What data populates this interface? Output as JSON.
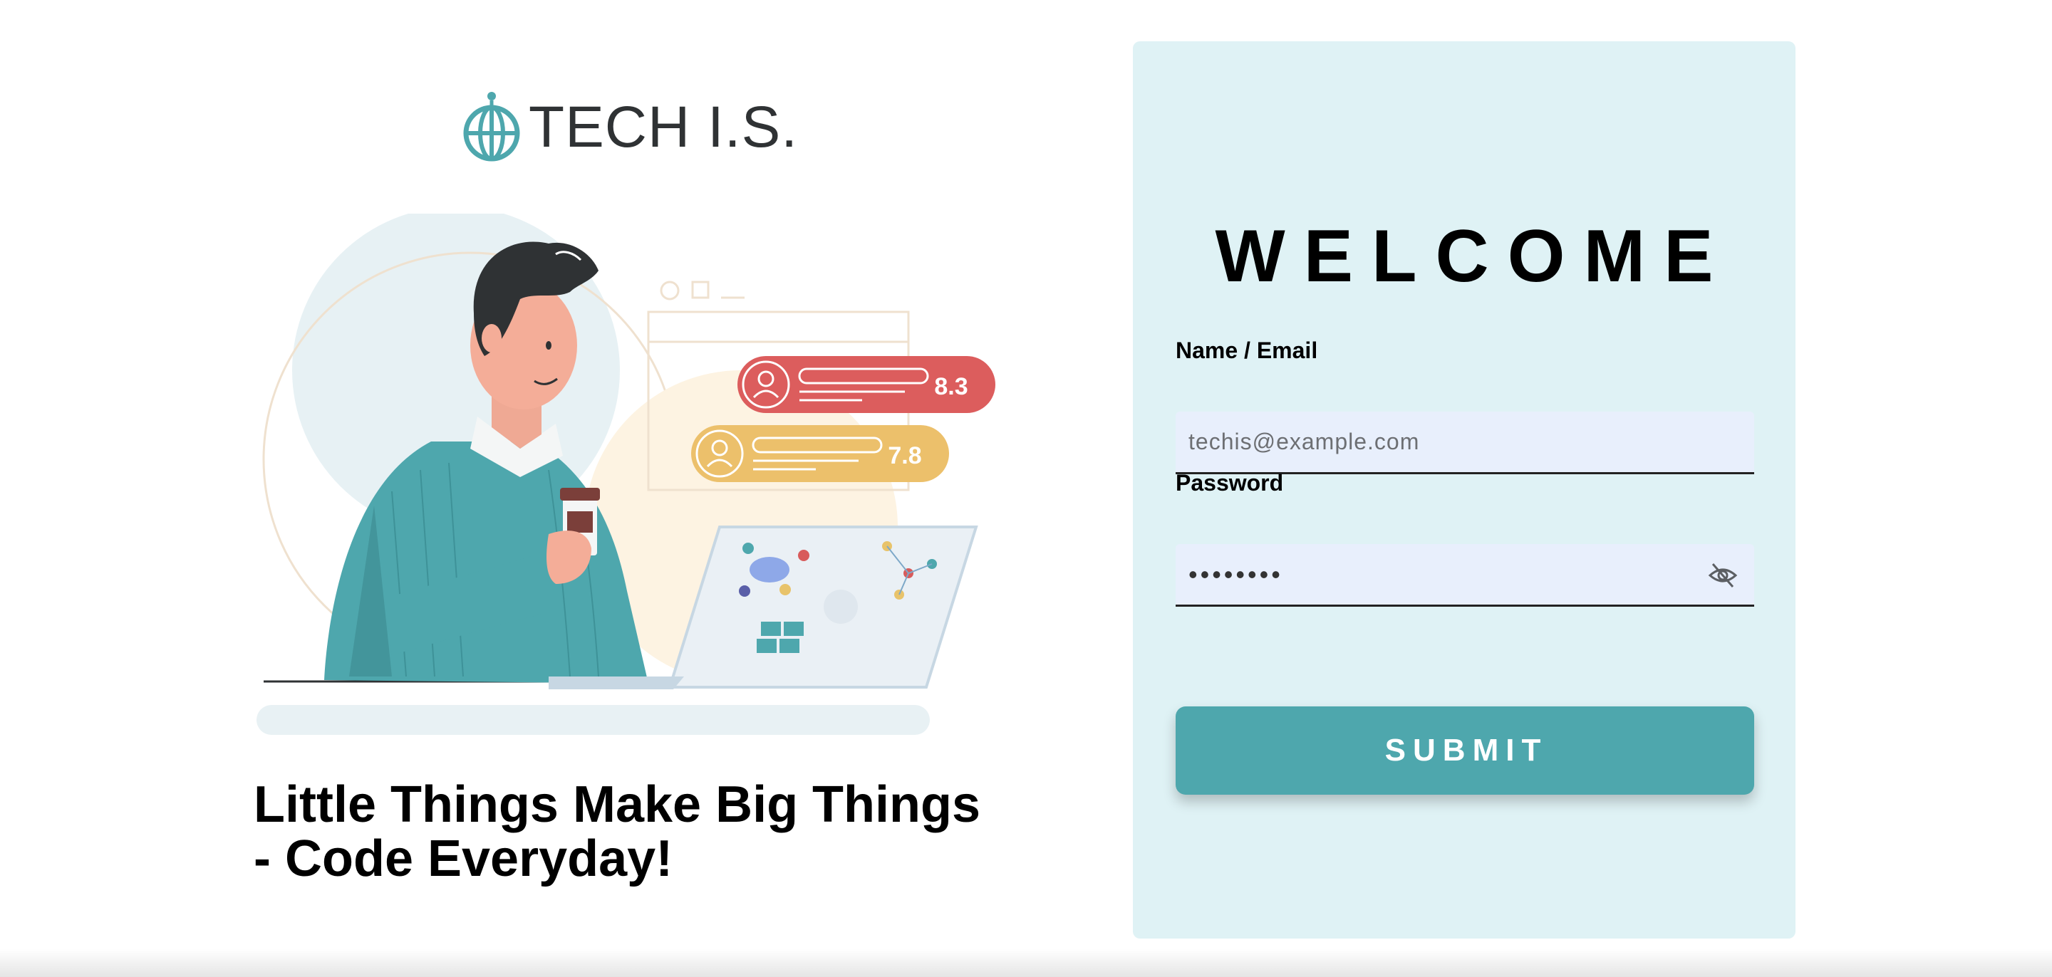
{
  "brand": {
    "name": "TECH I.S.",
    "logo_icon": "globe-pin-icon",
    "accent_color": "#4ea7ad"
  },
  "hero": {
    "illustration": "developer-with-laptop-and-coffee-illustration",
    "scores": [
      "8.3",
      "7.8"
    ],
    "tagline_line1": "Little Things Make Big Things",
    "tagline_line2": "- Code Everyday!"
  },
  "login": {
    "title": "WELCOME",
    "email": {
      "label": "Name / Email",
      "placeholder": "techis@example.com",
      "value": ""
    },
    "password": {
      "label": "Password",
      "value": "••••••••",
      "toggle_icon": "eye-off-icon"
    },
    "submit_label": "SUBMIT",
    "panel_color": "#dff2f5",
    "input_bg": "#e8effc"
  }
}
